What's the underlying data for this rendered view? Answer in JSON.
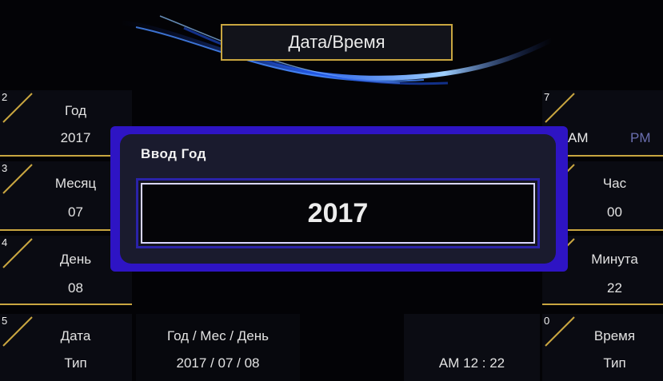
{
  "header": {
    "title": "Дата/Время"
  },
  "left_tiles": [
    {
      "num": "2",
      "label": "Год",
      "value": "2017"
    },
    {
      "num": "3",
      "label": "Месяц",
      "value": "07"
    },
    {
      "num": "4",
      "label": "День",
      "value": "08"
    },
    {
      "num": "5",
      "label": "Дата",
      "value": "Тип"
    }
  ],
  "right_tiles": {
    "ampm": {
      "num": "7",
      "am": "AM",
      "pm": "PM"
    },
    "hour": {
      "label": "Час",
      "value": "00"
    },
    "minute": {
      "label": "Минута",
      "value": "22"
    },
    "time_type": {
      "num": "0",
      "label": "Время",
      "value": "Тип"
    }
  },
  "date_format": {
    "label": "Год / Мес / День",
    "value": "2017 / 07 / 08"
  },
  "current_time": "AM 12 : 22",
  "modal": {
    "title": "Ввод Год",
    "value": "2017"
  },
  "colors": {
    "accent": "#c9a640",
    "modal_border": "#2e14c4",
    "pm_inactive": "#6b6fb0"
  }
}
